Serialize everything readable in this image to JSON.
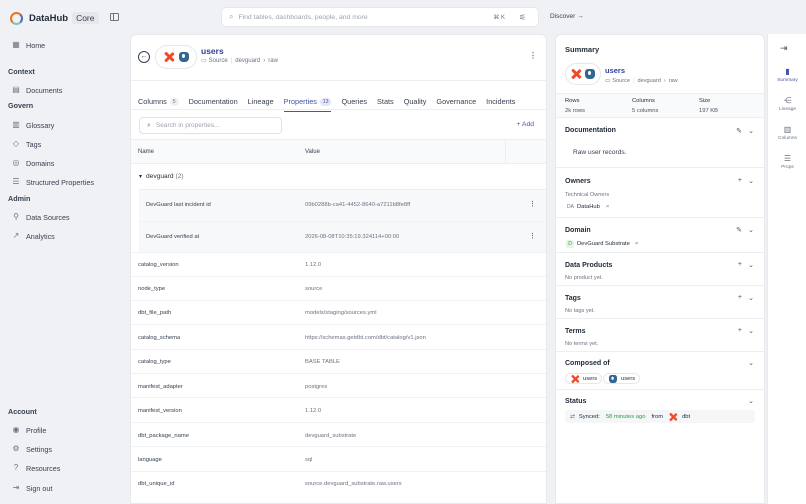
{
  "app": {
    "name": "DataHub",
    "edition": "Core"
  },
  "sidebar": {
    "home": "Home",
    "context_heading": "Context",
    "documents": "Documents",
    "govern_heading": "Govern",
    "glossary": "Glossary",
    "tags": "Tags",
    "domains": "Domains",
    "structured_properties": "Structured Properties",
    "admin_heading": "Admin",
    "data_sources": "Data Sources",
    "analytics": "Analytics",
    "account_heading": "Account",
    "profile": "Profile",
    "settings": "Settings",
    "resources": "Resources",
    "sign_out": "Sign out"
  },
  "search": {
    "placeholder": "Find tables, dashboards, people, and more",
    "shortcut": "⌘ K"
  },
  "discover": "Discover →",
  "entity": {
    "name": "users",
    "type": "Source",
    "path1": "devguard",
    "path2": "raw"
  },
  "tabs": [
    {
      "label": "Columns",
      "count": "5"
    },
    {
      "label": "Documentation"
    },
    {
      "label": "Lineage"
    },
    {
      "label": "Properties",
      "count": "13"
    },
    {
      "label": "Queries"
    },
    {
      "label": "Stats"
    },
    {
      "label": "Quality"
    },
    {
      "label": "Governance"
    },
    {
      "label": "Incidents"
    }
  ],
  "properties": {
    "search_placeholder": "Search in properties...",
    "add_label": "+ Add",
    "col_name": "Name",
    "col_value": "Value",
    "group": {
      "name": "devguard",
      "count": "(2)"
    },
    "nested": [
      {
        "key": "DevGuard last incident id",
        "value": "09b0288b-ca41-4452-8640-a7211b8fe8ff"
      },
      {
        "key": "DevGuard verified at",
        "value": "2026-08-08T10:35:19.324114+00:00"
      }
    ],
    "rows": [
      {
        "key": "catalog_version",
        "value": "1.12.0"
      },
      {
        "key": "node_type",
        "value": "source"
      },
      {
        "key": "dbt_file_path",
        "value": "models/staging/sources.yml"
      },
      {
        "key": "catalog_schema",
        "value": "https://schemas.getdbt.com/dbt/catalog/v1.json"
      },
      {
        "key": "catalog_type",
        "value": "BASE TABLE"
      },
      {
        "key": "manifest_adapter",
        "value": "postgres"
      },
      {
        "key": "manifest_version",
        "value": "1.12.0"
      },
      {
        "key": "dbt_package_name",
        "value": "devguard_substrate"
      },
      {
        "key": "language",
        "value": "sql"
      },
      {
        "key": "dbt_unique_id",
        "value": "source.devguard_substrate.raw.users"
      }
    ]
  },
  "summary": {
    "title": "Summary",
    "stats": {
      "rows_label": "Rows",
      "rows_value": "2k rows",
      "columns_label": "Columns",
      "columns_value": "5 columns",
      "size_label": "Size",
      "size_value": "197 KB"
    },
    "documentation": {
      "heading": "Documentation",
      "text": "Raw user records."
    },
    "owners": {
      "heading": "Owners",
      "sub": "Technical Owners",
      "owner_initials": "DA",
      "owner": "DataHub"
    },
    "domain": {
      "heading": "Domain",
      "initial": "D",
      "value": "DevGuard Substrate"
    },
    "data_products": {
      "heading": "Data Products",
      "empty": "No product yet."
    },
    "tags": {
      "heading": "Tags",
      "empty": "No tags yet."
    },
    "terms": {
      "heading": "Terms",
      "empty": "No terms yet."
    },
    "composed_of": {
      "heading": "Composed of",
      "item1": "users",
      "item2": "users"
    },
    "status": {
      "heading": "Status",
      "synced_label": "Synced:",
      "synced_time": "58 minutes ago",
      "from": "from",
      "source": "dbt"
    }
  },
  "rail": {
    "summary": "Summary",
    "lineage": "Lineage",
    "columns": "Columns",
    "props": "Props"
  },
  "colors": {
    "accent": "#4454a6",
    "title": "#2f3f95",
    "success": "#2e9b48",
    "dbt": "#ef4b2b",
    "postgres": "#336791"
  }
}
